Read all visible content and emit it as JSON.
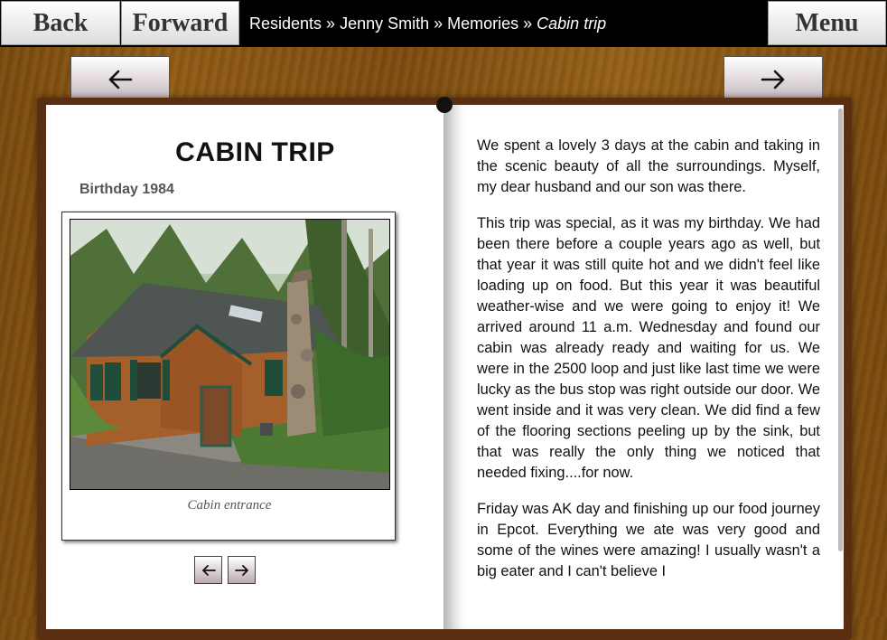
{
  "nav": {
    "back_label": "Back",
    "forward_label": "Forward",
    "menu_label": "Menu"
  },
  "breadcrumb": {
    "items": [
      "Residents",
      "Jenny Smith",
      "Memories"
    ],
    "separator": "»",
    "current": "Cabin trip"
  },
  "page_tabs": {
    "prev_icon": "arrow-left-icon",
    "next_icon": "arrow-right-icon"
  },
  "memory": {
    "title": "CABIN TRIP",
    "subtitle": "Birthday 1984",
    "photo": {
      "caption": "Cabin entrance"
    },
    "photo_nav": {
      "prev_icon": "arrow-left-icon",
      "next_icon": "arrow-right-icon"
    },
    "paragraphs": [
      "We spent a lovely 3 days at the cabin and taking in the scenic beauty of all the surroundings. Myself, my dear husband and our son was there.",
      "This trip was special, as it was my birthday. We had been there before a couple years ago as well, but that year it was still quite hot and we didn't feel like loading up on food. But this year it was beautiful weather-wise and we were going to enjoy it! We arrived around 11 a.m. Wednesday and found our cabin was already ready and waiting for us. We were in the 2500 loop and just like last time we were lucky as the bus stop was right outside our door. We went inside and it was very clean. We did find a few of the flooring sections peeling up by the sink, but that was really the only thing we noticed that needed fixing....for now.",
      "Friday was AK day and finishing up our food journey in Epcot. Everything we ate was very good and some of the wines were amazing! I usually wasn't a big eater and I can't believe I"
    ]
  },
  "colors": {
    "wood": "#8f5a14",
    "topbar": "#000000",
    "page": "#ffffff"
  }
}
